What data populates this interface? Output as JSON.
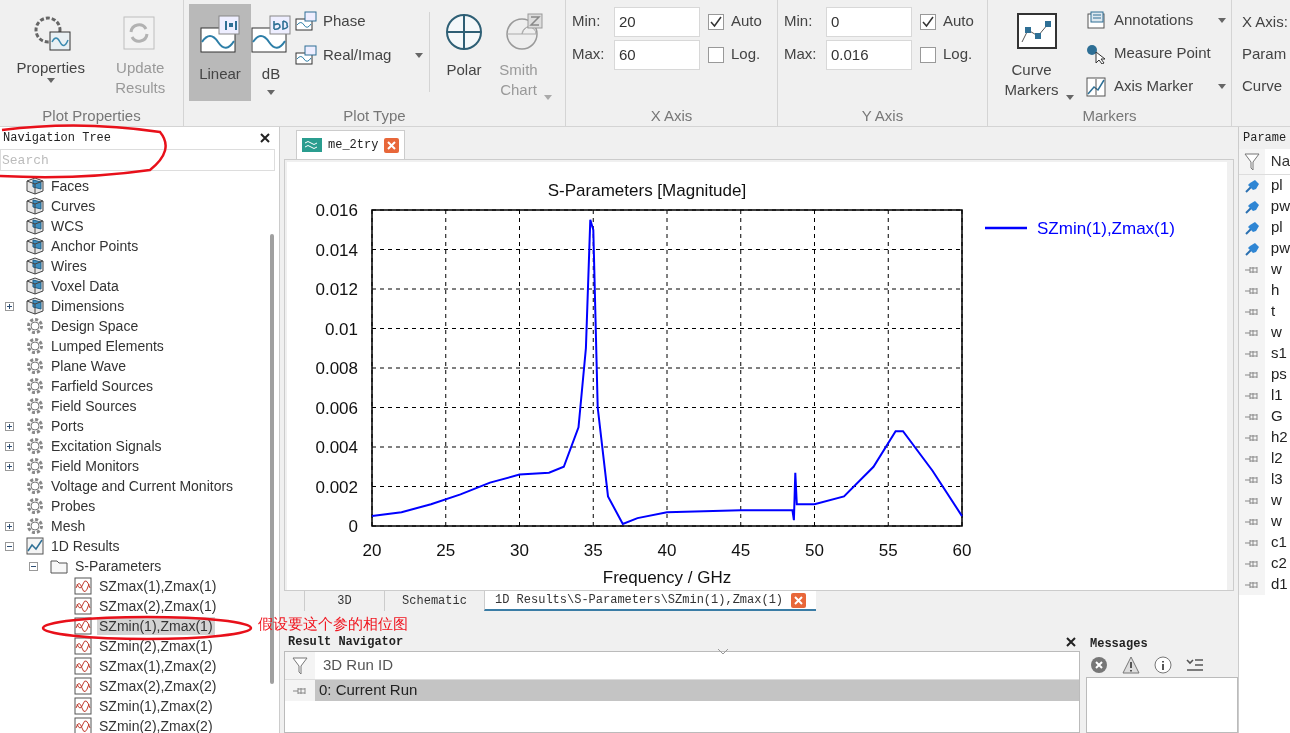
{
  "ribbon": {
    "plot_properties": {
      "label": "Plot Properties",
      "buttons": [
        {
          "label": "Properties",
          "dropdown": true,
          "disabled": false
        },
        {
          "label": "Update Results",
          "dropdown": false,
          "disabled": true
        }
      ]
    },
    "plot_type": {
      "label": "Plot Type",
      "large": [
        {
          "label": "Linear",
          "selected": true,
          "dropdown": false
        },
        {
          "label": "dB",
          "selected": false,
          "dropdown": true
        }
      ],
      "small": [
        {
          "label": "Phase",
          "dropdown": false
        },
        {
          "label": "Real/Imag",
          "dropdown": true
        }
      ],
      "views": [
        {
          "label": "Polar",
          "disabled": false,
          "dropdown": false
        },
        {
          "label": "Smith Chart",
          "disabled": true,
          "dropdown": true
        }
      ]
    },
    "axes": [
      {
        "label": "X Axis",
        "min_label": "Min:",
        "min": "20",
        "max_label": "Max:",
        "max": "60",
        "auto_label": "Auto",
        "auto": true,
        "log_label": "Log.",
        "log": false
      },
      {
        "label": "Y Axis",
        "min_label": "Min:",
        "min": "0",
        "max_label": "Max:",
        "max": "0.016",
        "auto_label": "Auto",
        "auto": true,
        "log_label": "Log.",
        "log": false
      }
    ],
    "markers": {
      "label": "Markers",
      "curve_markers": "Curve Markers",
      "items": [
        {
          "label": "Annotations",
          "dropdown": true
        },
        {
          "label": "Measure Point",
          "dropdown": false
        },
        {
          "label": "Axis Marker",
          "dropdown": true
        }
      ]
    },
    "cut_group": [
      "X Axis:",
      "Param",
      "Curve"
    ]
  },
  "navigation_tree": {
    "title": "Navigation Tree",
    "placeholder": "Search",
    "items": [
      {
        "label": "Faces",
        "kind": "cube",
        "selected": false
      },
      {
        "label": "Curves",
        "kind": "cube",
        "selected": false
      },
      {
        "label": "WCS",
        "kind": "cube",
        "selected": false
      },
      {
        "label": "Anchor Points",
        "kind": "cube",
        "selected": false
      },
      {
        "label": "Wires",
        "kind": "cube",
        "selected": false
      },
      {
        "label": "Voxel Data",
        "kind": "cube",
        "selected": false
      },
      {
        "label": "Dimensions",
        "kind": "cube",
        "expanded": false,
        "selected": false
      },
      {
        "label": "Design Space",
        "kind": "gear",
        "selected": false
      },
      {
        "label": "Lumped Elements",
        "kind": "gear",
        "selected": false
      },
      {
        "label": "Plane Wave",
        "kind": "gear",
        "selected": false
      },
      {
        "label": "Farfield Sources",
        "kind": "gear",
        "selected": false
      },
      {
        "label": "Field Sources",
        "kind": "gear",
        "selected": false
      },
      {
        "label": "Ports",
        "kind": "gear",
        "expanded": false,
        "selected": false
      },
      {
        "label": "Excitation Signals",
        "kind": "gear",
        "expanded": false,
        "selected": false
      },
      {
        "label": "Field Monitors",
        "kind": "gear",
        "expanded": false,
        "selected": false
      },
      {
        "label": "Voltage and Current Monitors",
        "kind": "gear",
        "selected": false
      },
      {
        "label": "Probes",
        "kind": "gear",
        "selected": false
      },
      {
        "label": "Mesh",
        "kind": "gear",
        "expanded": false,
        "selected": false
      },
      {
        "label": "1D Results",
        "kind": "graph",
        "expanded": true,
        "selected": false,
        "children": [
          {
            "label": "S-Parameters",
            "kind": "folder",
            "expanded": true,
            "selected": false,
            "children": [
              {
                "label": "SZmax(1),Zmax(1)",
                "kind": "curve",
                "selected": false
              },
              {
                "label": "SZmax(2),Zmax(1)",
                "kind": "curve",
                "selected": false
              },
              {
                "label": "SZmin(1),Zmax(1)",
                "kind": "curve",
                "selected": true
              },
              {
                "label": "SZmin(2),Zmax(1)",
                "kind": "curve",
                "selected": false
              },
              {
                "label": "SZmax(1),Zmax(2)",
                "kind": "curve",
                "selected": false
              },
              {
                "label": "SZmax(2),Zmax(2)",
                "kind": "curve",
                "selected": false
              },
              {
                "label": "SZmin(1),Zmax(2)",
                "kind": "curve",
                "selected": false
              },
              {
                "label": "SZmin(2),Zmax(2)",
                "kind": "curve",
                "selected": false
              }
            ]
          }
        ]
      }
    ]
  },
  "document_tab": {
    "label": "me_2try",
    "closable": true
  },
  "plot": {
    "chart_data": {
      "type": "line",
      "title": "S-Parameters [Magnitude]",
      "xlabel": "Frequency / GHz",
      "x": [
        20,
        22,
        24,
        26,
        28,
        30,
        32,
        33,
        34,
        34.5,
        34.8,
        35,
        35.3,
        36,
        37,
        38,
        40,
        45,
        48.5,
        48.6,
        48.7,
        48.8,
        50,
        52,
        54,
        55.5,
        56,
        58,
        60
      ],
      "series": [
        {
          "name": "SZmin(1),Zmax(1)",
          "color": "#0000ff",
          "values": [
            0.0005,
            0.0007,
            0.0011,
            0.0016,
            0.0022,
            0.0026,
            0.0027,
            0.003,
            0.005,
            0.009,
            0.0155,
            0.015,
            0.006,
            0.0015,
            0.0001,
            0.0004,
            0.0007,
            0.0008,
            0.0008,
            0.0003,
            0.0027,
            0.0011,
            0.0011,
            0.0015,
            0.003,
            0.0048,
            0.0048,
            0.0028,
            0.0005
          ]
        }
      ],
      "grid": true,
      "xlim": [
        20,
        60
      ],
      "ylim": [
        0,
        0.016
      ],
      "xticks": [
        20,
        25,
        30,
        35,
        40,
        45,
        50,
        55,
        60
      ],
      "yticks": [
        0,
        0.002,
        0.004,
        0.006,
        0.008,
        0.01,
        0.012,
        0.014,
        0.016
      ]
    }
  },
  "view_tabs": [
    {
      "label": "3D",
      "selected": false,
      "closable": false
    },
    {
      "label": "Schematic",
      "selected": false,
      "closable": false
    },
    {
      "label": "1D Results\\S-Parameters\\SZmin(1),Zmax(1)",
      "selected": true,
      "closable": true
    }
  ],
  "result_navigator": {
    "title": "Result Navigator",
    "column": "3D Run ID",
    "rows": [
      {
        "label": "0: Current Run",
        "selected": true
      }
    ]
  },
  "messages": {
    "title": "Messages"
  },
  "parameters": {
    "title": "Parame",
    "column": "Na",
    "rows": [
      {
        "name": "pl",
        "kind": "pinned"
      },
      {
        "name": "pw",
        "kind": "pinned"
      },
      {
        "name": "pl",
        "kind": "pinned"
      },
      {
        "name": "pw",
        "kind": "pinned"
      },
      {
        "name": "w",
        "kind": "plain"
      },
      {
        "name": "h",
        "kind": "plain"
      },
      {
        "name": "t",
        "kind": "plain"
      },
      {
        "name": "w",
        "kind": "plain"
      },
      {
        "name": "s1",
        "kind": "plain"
      },
      {
        "name": "ps",
        "kind": "plain"
      },
      {
        "name": "l1",
        "kind": "plain"
      },
      {
        "name": "G",
        "kind": "plain"
      },
      {
        "name": "h2",
        "kind": "plain"
      },
      {
        "name": "l2",
        "kind": "plain"
      },
      {
        "name": "l3",
        "kind": "plain"
      },
      {
        "name": "w",
        "kind": "plain"
      },
      {
        "name": "w",
        "kind": "plain"
      },
      {
        "name": "c1",
        "kind": "plain"
      },
      {
        "name": "c2",
        "kind": "plain"
      },
      {
        "name": "d1",
        "kind": "plain"
      }
    ]
  },
  "annotations": {
    "note": "假设要这个参的相位图"
  }
}
